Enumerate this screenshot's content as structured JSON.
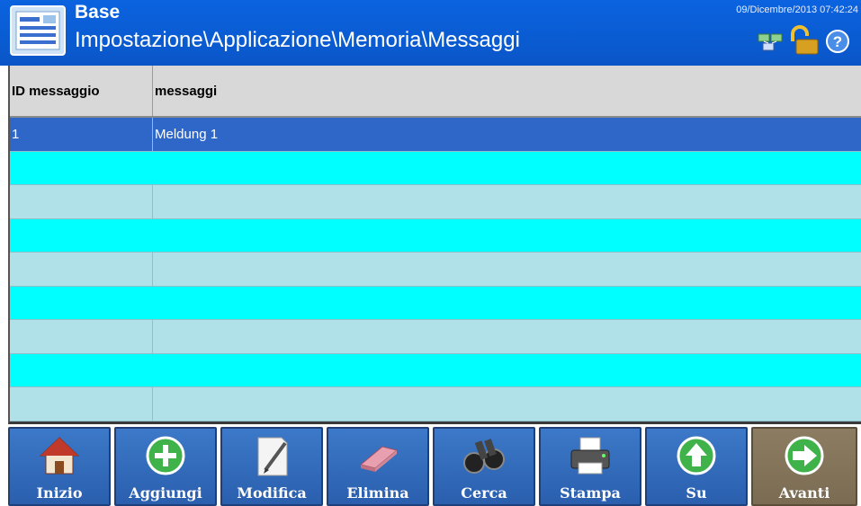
{
  "header": {
    "title": "Base",
    "path": "Impostazione\\Applicazione\\Memoria\\Messaggi",
    "datetime": "09/Dicembre/2013 07:42:24",
    "icons": [
      "app-icon",
      "network-icon",
      "unlock-icon",
      "help-icon"
    ]
  },
  "table": {
    "columns": [
      "ID messaggio",
      "messaggi"
    ],
    "rows": [
      [
        "1",
        "Meldung 1"
      ],
      [
        "",
        ""
      ],
      [
        "",
        ""
      ],
      [
        "",
        ""
      ],
      [
        "",
        ""
      ],
      [
        "",
        ""
      ],
      [
        "",
        ""
      ],
      [
        "",
        ""
      ],
      [
        "",
        ""
      ]
    ],
    "selected_row": 0
  },
  "footer": {
    "buttons": [
      {
        "label": "Inizio",
        "icon": "home-icon"
      },
      {
        "label": "Aggiungi",
        "icon": "plus-circle-icon"
      },
      {
        "label": "Modifica",
        "icon": "edit-pen-icon"
      },
      {
        "label": "Elimina",
        "icon": "eraser-icon"
      },
      {
        "label": "Cerca",
        "icon": "binoculars-icon"
      },
      {
        "label": "Stampa",
        "icon": "printer-icon"
      },
      {
        "label": "Su",
        "icon": "up-arrow-icon"
      },
      {
        "label": "Avanti",
        "icon": "right-arrow-icon"
      }
    ]
  },
  "colors": {
    "header_bg": "#0a5fd8",
    "selected_row": "#2f67c8",
    "row_cyan": "#00ffff",
    "row_light": "#b0e0e8",
    "button_bg": "#3c79c8",
    "button_next_bg": "#8c7d62"
  }
}
